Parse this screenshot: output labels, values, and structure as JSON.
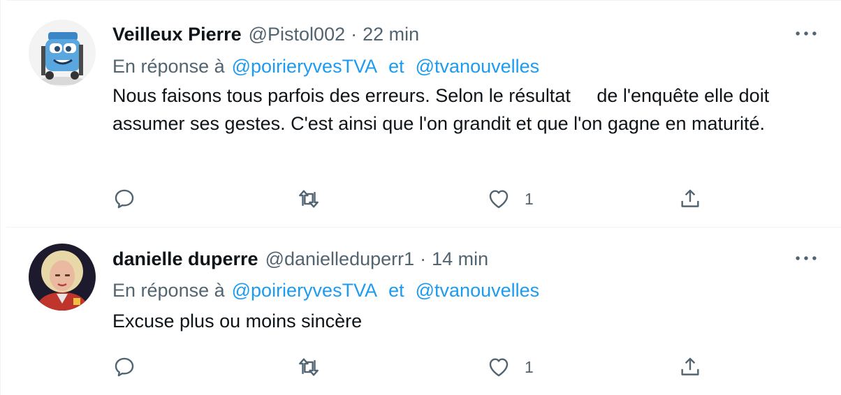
{
  "colors": {
    "link": "#1d9bf0",
    "secondary_text": "#536471",
    "primary_text": "#0f1419",
    "divider": "#eff3f4"
  },
  "tweets": [
    {
      "display_name": "Veilleux Pierre",
      "handle": "@Pistol002",
      "separator": "·",
      "time": "22 min",
      "reply_prefix": "En réponse à",
      "reply_to_1": "@poirieryvesTVA",
      "reply_conj": "et",
      "reply_to_2": "@tvanouvelles",
      "text": "Nous faisons tous parfois des erreurs. Selon le résultat     de l'enquête elle doit assumer ses gestes. C'est ainsi que l'on grandit et que l'on gagne en maturité.",
      "like_count": "1",
      "avatar_icon": "cartoon-forklift-avatar"
    },
    {
      "display_name": "danielle duperre",
      "handle": "@danielleduperr1",
      "separator": "·",
      "time": "14 min",
      "reply_prefix": "En réponse à",
      "reply_to_1": "@poirieryvesTVA",
      "reply_conj": "et",
      "reply_to_2": "@tvanouvelles",
      "text": "Excuse plus ou moins sincère",
      "like_count": "1",
      "avatar_icon": "portrait-photo-avatar"
    }
  ],
  "icons": {
    "more": "more-horizontal-icon",
    "reply": "reply-icon",
    "retweet": "retweet-icon",
    "like": "heart-icon",
    "share": "share-icon"
  }
}
